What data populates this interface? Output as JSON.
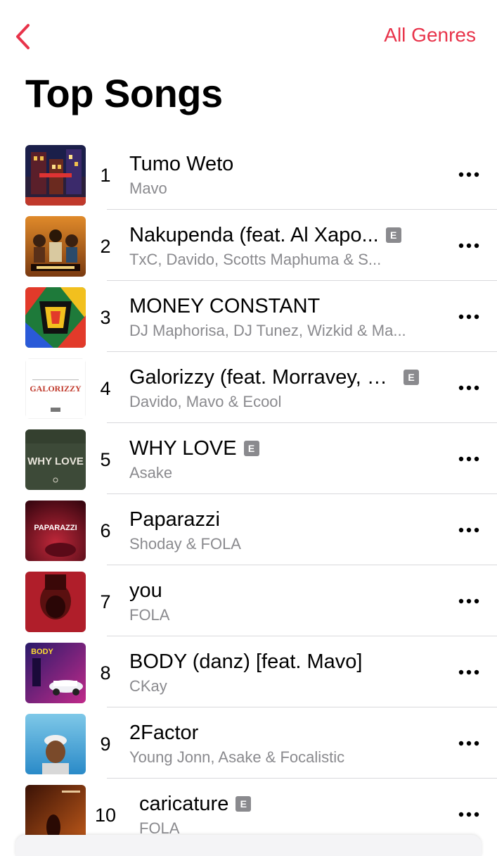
{
  "nav": {
    "back_label": "Back",
    "all_genres": "All Genres",
    "accent": "#e8334a"
  },
  "page_title": "Top Songs",
  "songs": [
    {
      "rank": "1",
      "title": "Tumo Weto",
      "artist": "Mavo",
      "explicit": false
    },
    {
      "rank": "2",
      "title": "Nakupenda (feat. Al Xapo...",
      "artist": "TxC, Davido, Scotts Maphuma & S...",
      "explicit": true
    },
    {
      "rank": "3",
      "title": "MONEY CONSTANT",
      "artist": "DJ Maphorisa, DJ Tunez, Wizkid & Ma...",
      "explicit": false
    },
    {
      "rank": "4",
      "title": "Galorizzy (feat. Morravey, S...",
      "artist": "Davido, Mavo & Ecool",
      "explicit": true
    },
    {
      "rank": "5",
      "title": "WHY LOVE",
      "artist": "Asake",
      "explicit": true
    },
    {
      "rank": "6",
      "title": "Paparazzi",
      "artist": "Shoday & FOLA",
      "explicit": false
    },
    {
      "rank": "7",
      "title": "you",
      "artist": "FOLA",
      "explicit": false
    },
    {
      "rank": "8",
      "title": "BODY (danz) [feat. Mavo]",
      "artist": "CKay",
      "explicit": false
    },
    {
      "rank": "9",
      "title": "2Factor",
      "artist": "Young Jonn, Asake & Focalistic",
      "explicit": false
    },
    {
      "rank": "10",
      "title": "caricature",
      "artist": "FOLA",
      "explicit": true
    }
  ],
  "explicit_badge": "E",
  "artwork_text": {
    "galorizzy": "GALORIZZY",
    "why_love": "WHY LOVE",
    "paparazzi": "PAPARAZZI",
    "body": "BODY"
  },
  "icons": {
    "back": "chevron-left-icon",
    "more": "ellipsis-icon"
  }
}
